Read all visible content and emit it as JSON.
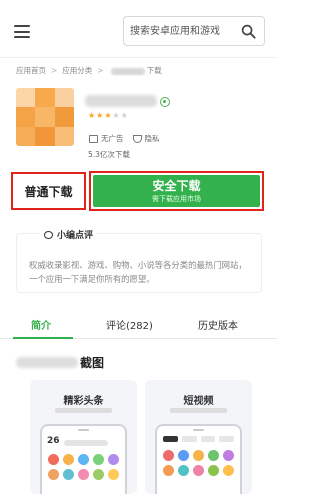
{
  "header": {
    "search_placeholder": "搜索安卓应用和游戏"
  },
  "breadcrumb": {
    "home": "应用首页",
    "category": "应用分类",
    "current_suffix": "下载"
  },
  "app": {
    "rating": {
      "value": 3,
      "max": 5
    },
    "tags": [
      "无广告",
      "隐私"
    ],
    "downloads": "5.3亿次下载"
  },
  "buttons": {
    "normal_download": "普通下载",
    "safe_download": "安全下载",
    "safe_download_sub": "需下载应用市场"
  },
  "editor_review": {
    "title": "小编点评",
    "text": "权威收录影视、游戏、购物、小说等各分类的最热门网站，一个应用一下满足你所有的愿望。"
  },
  "tabs": [
    {
      "label": "简介",
      "active": true
    },
    {
      "label": "评论(282)",
      "active": false
    },
    {
      "label": "历史版本",
      "active": false
    }
  ],
  "screenshots": {
    "title_suffix": "截图",
    "items": [
      {
        "title": "精彩头条",
        "phone_date": "26"
      },
      {
        "title": "短视频"
      }
    ]
  },
  "colors": {
    "accent_green": "#33b14d",
    "highlight_red": "#e2231a",
    "star": "#f5a623"
  }
}
